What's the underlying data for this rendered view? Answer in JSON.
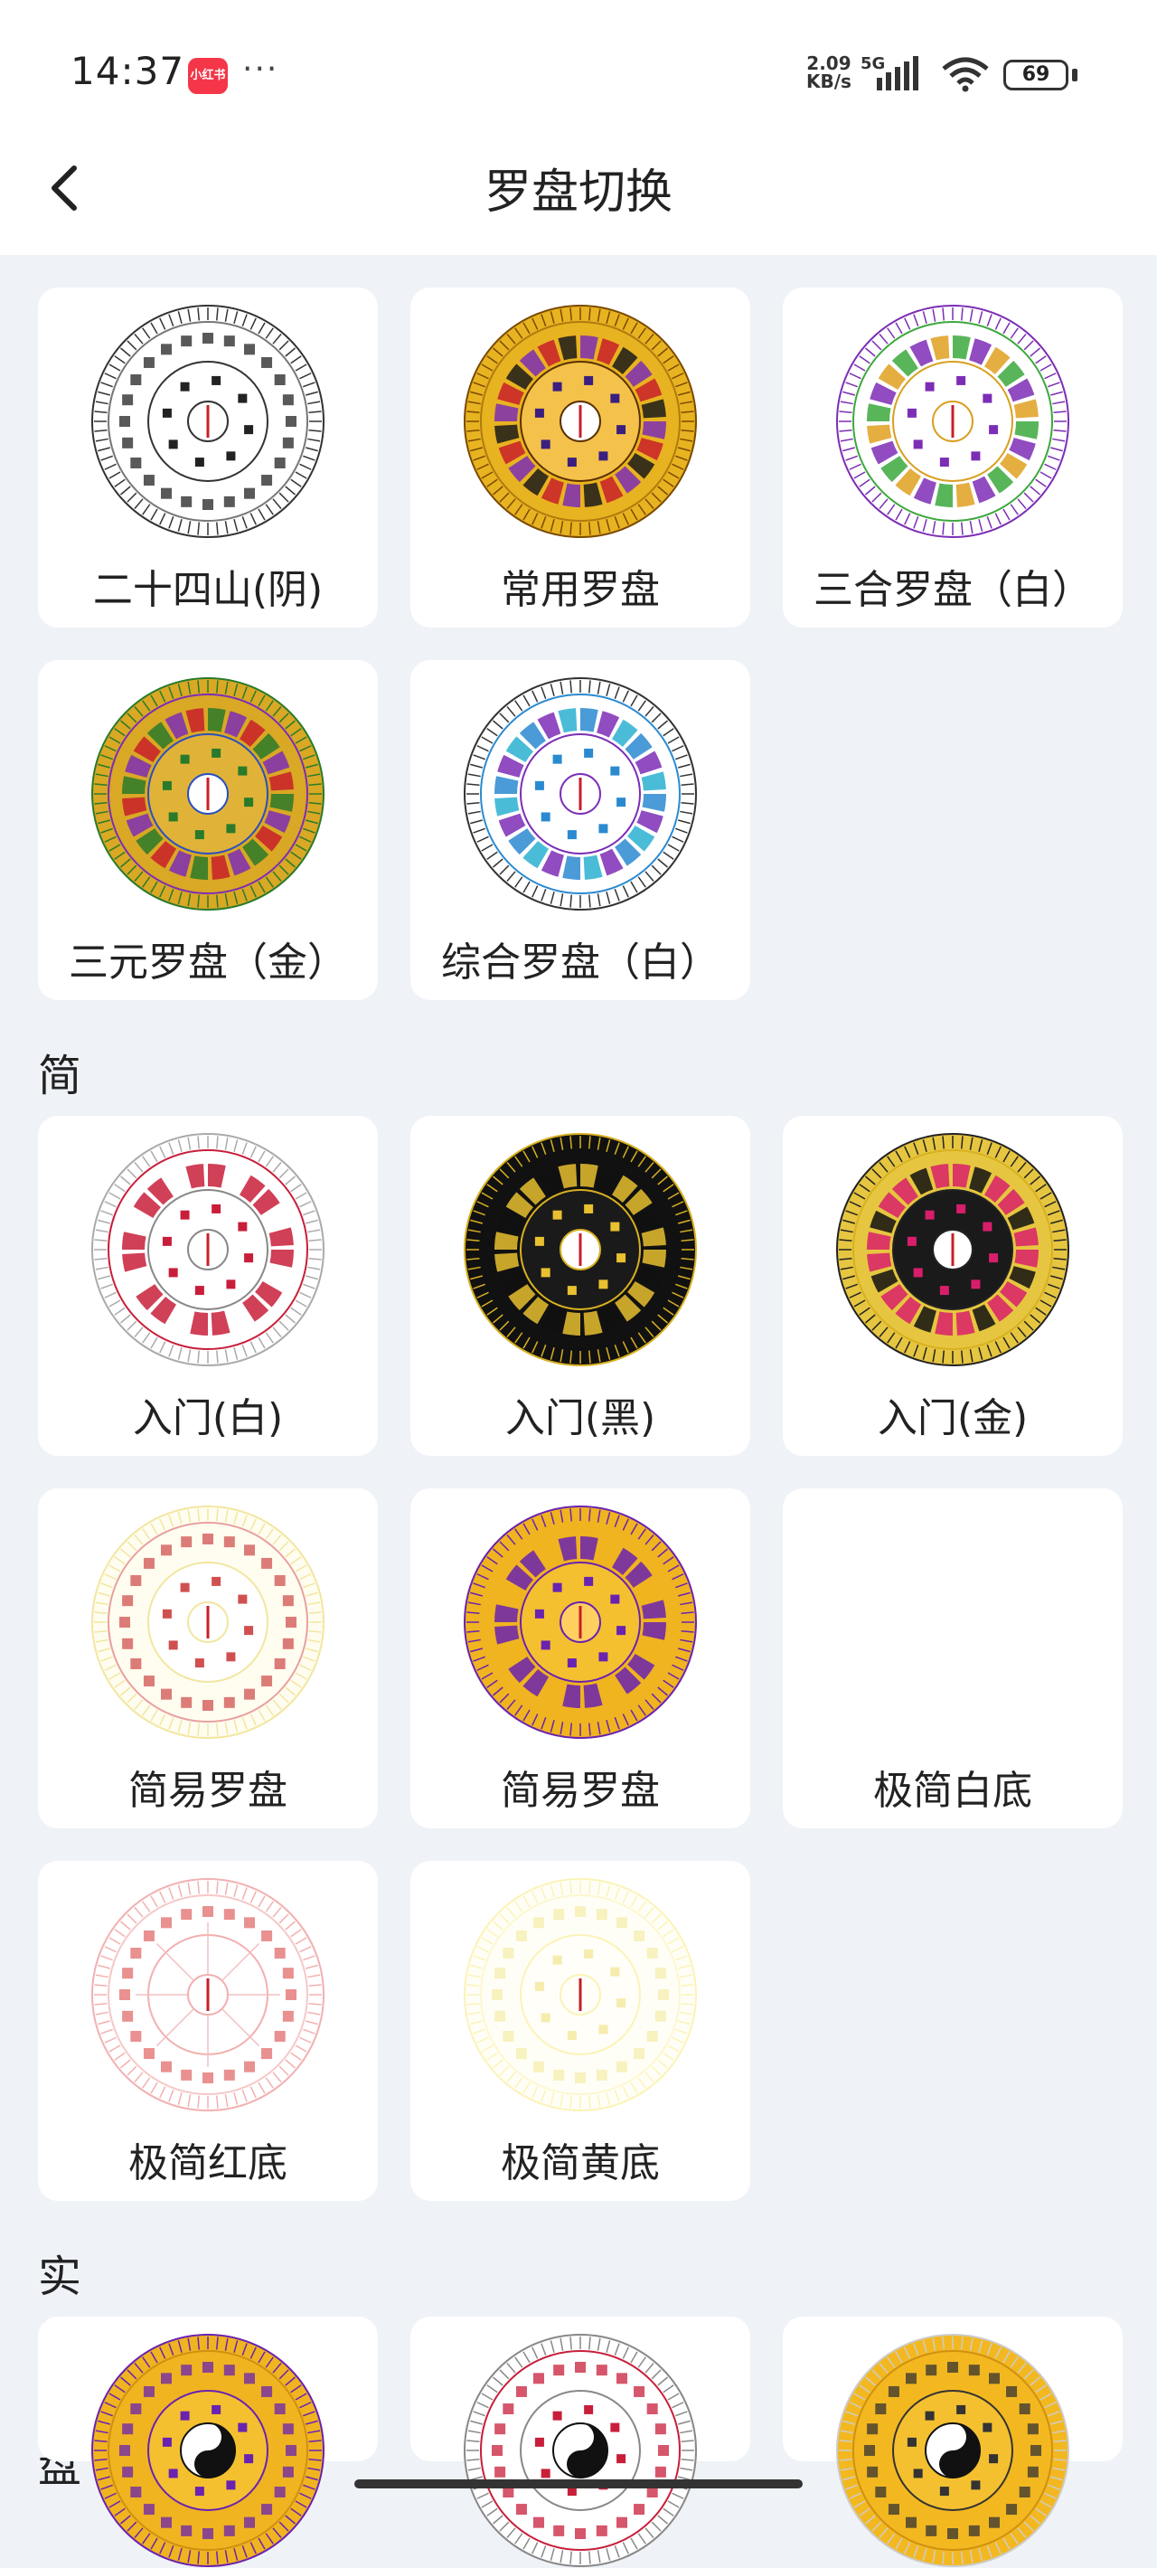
{
  "status": {
    "time": "14:37",
    "app_badge": "小红书",
    "more": "···",
    "net_speed_top": "2.09",
    "net_speed_bottom": "KB/s",
    "network": "5G",
    "battery": "69"
  },
  "header": {
    "title": "罗盘切换"
  },
  "groups": [
    {
      "title": "",
      "items": [
        {
          "label": "二十四山(阴)",
          "style": "white-ring"
        },
        {
          "label": "常用罗盘",
          "style": "gold-dense"
        },
        {
          "label": "三合罗盘（白）",
          "style": "white-color"
        },
        {
          "label": "三元罗盘（金）",
          "style": "gold-color"
        },
        {
          "label": "综合罗盘（白）",
          "style": "white-blue"
        }
      ]
    },
    {
      "title": "简易罗盘",
      "items": [
        {
          "label": "入门(白)",
          "style": "white-red"
        },
        {
          "label": "入门(黑)",
          "style": "black-gold"
        },
        {
          "label": "入门(金)",
          "style": "gold-black"
        },
        {
          "label": "简易罗盘",
          "style": "cream-ring"
        },
        {
          "label": "简易罗盘",
          "style": "gold-purple"
        },
        {
          "label": "极简白底",
          "style": "empty"
        },
        {
          "label": "极简红底",
          "style": "red-line"
        },
        {
          "label": "极简黄底",
          "style": "yellow-faint"
        }
      ]
    },
    {
      "title": "实用罗盘",
      "items": [
        {
          "label": "",
          "style": "gold-yinyang"
        },
        {
          "label": "",
          "style": "white-yinyang"
        },
        {
          "label": "",
          "style": "gold-yinyang2"
        }
      ]
    }
  ]
}
